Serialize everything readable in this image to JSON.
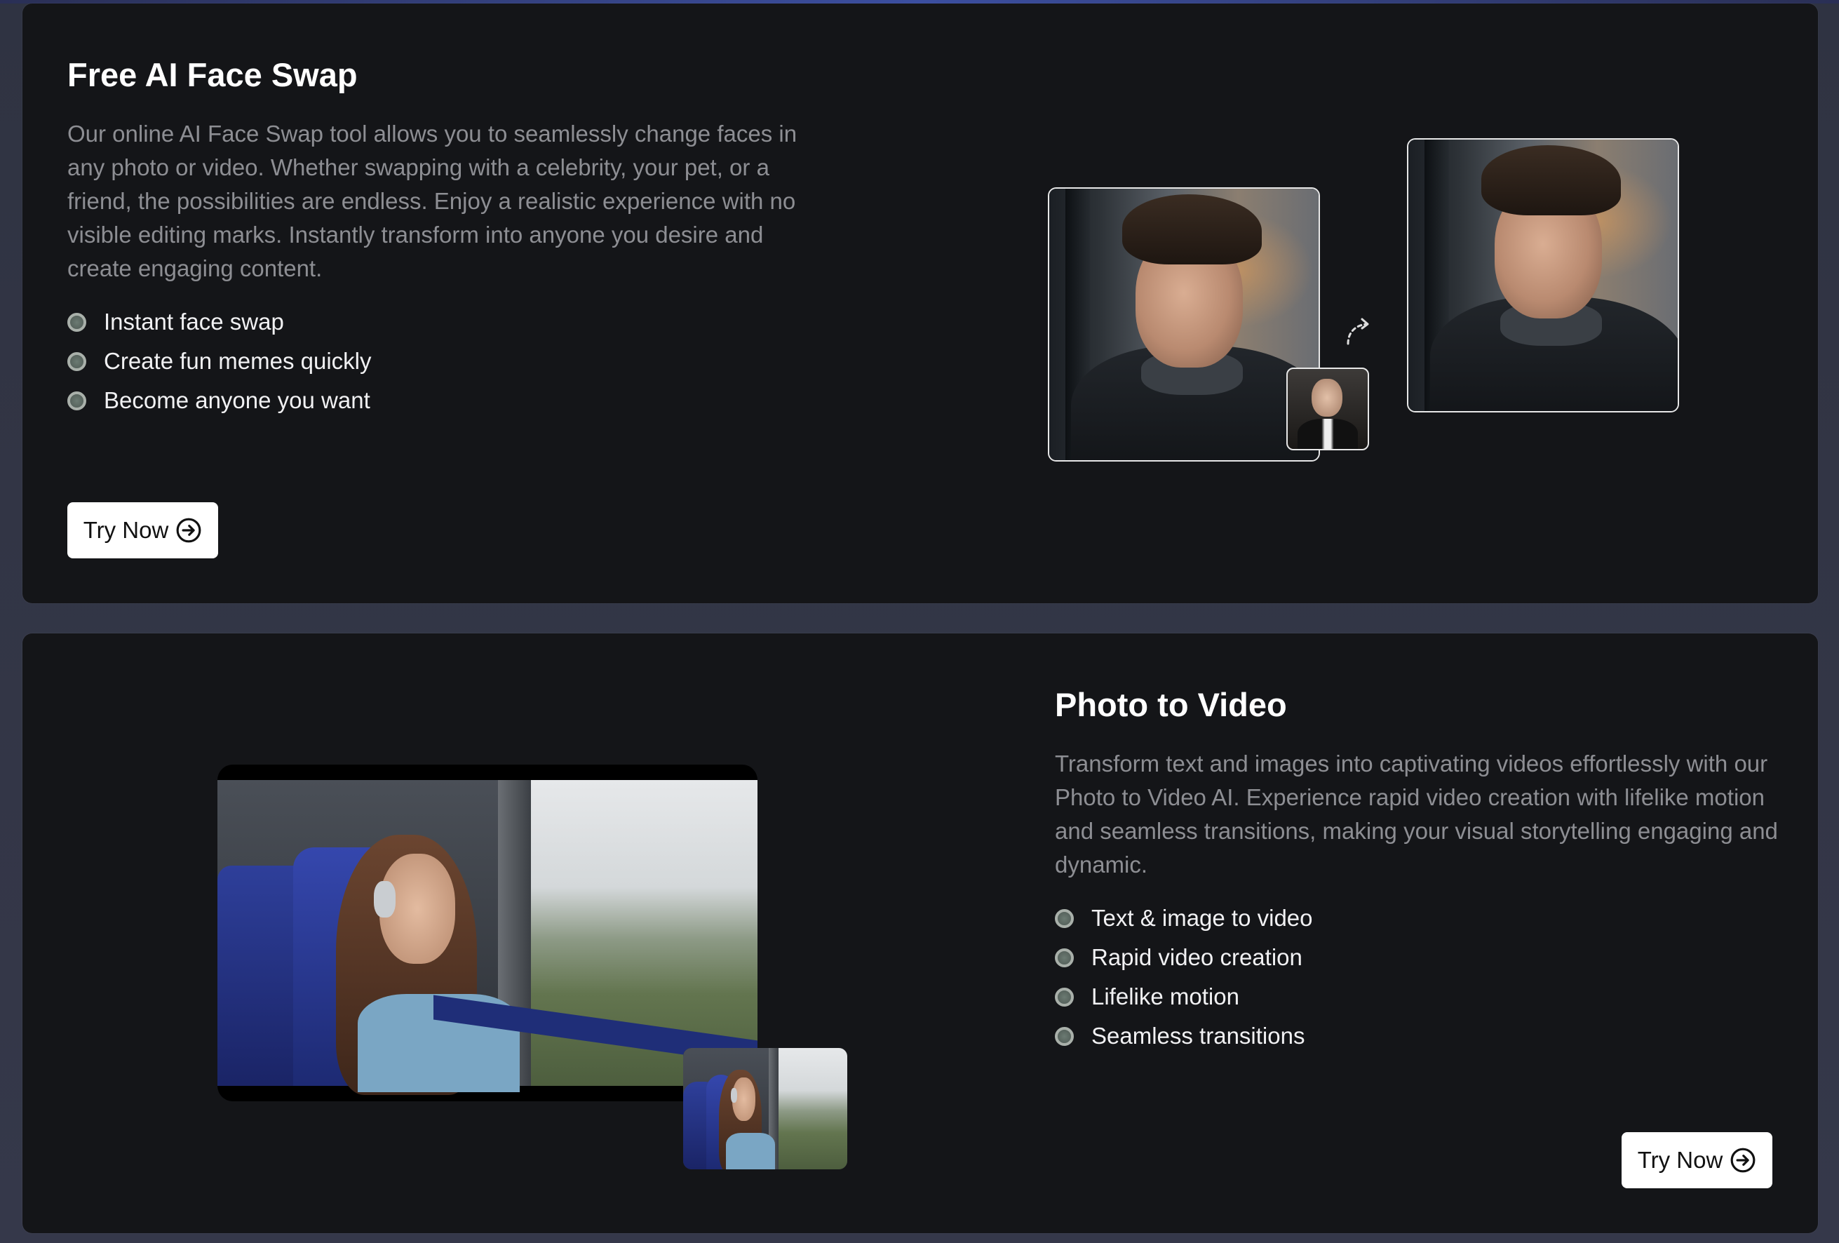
{
  "sections": [
    {
      "title": "Free AI Face Swap",
      "description": "Our online AI Face Swap tool allows you to seamlessly change faces in any photo or video. Whether swapping with a celebrity, your pet, or a friend, the possibilities are endless. Enjoy a realistic experience with no visible editing marks. Instantly transform into anyone you desire and create engaging content.",
      "features": [
        "Instant face swap",
        "Create fun memes quickly",
        "Become anyone you want"
      ],
      "button_label": "Try Now",
      "button_icon": "arrow-right-circle-icon"
    },
    {
      "title": "Photo to Video",
      "description": "Transform text and images into captivating videos effortlessly with our Photo to Video AI. Experience rapid video creation with lifelike motion and seamless transitions, making your visual storytelling engaging and dynamic.",
      "features": [
        "Text & image to video",
        "Rapid video creation",
        "Lifelike motion",
        "Seamless transitions"
      ],
      "button_label": "Try Now",
      "button_icon": "arrow-right-circle-icon"
    }
  ],
  "colors": {
    "page_background": "#313444",
    "card_background": "#141518",
    "title": "#ffffff",
    "description": "#8d8e93",
    "feature_text": "#f1f1f3",
    "button_background": "#ffffff",
    "button_text": "#111111"
  }
}
